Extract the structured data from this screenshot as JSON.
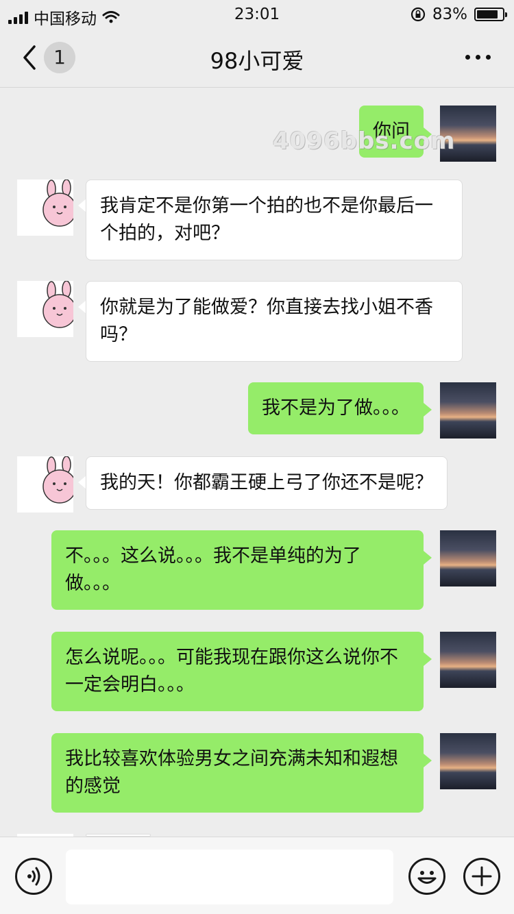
{
  "status_bar": {
    "carrier": "中国移动",
    "time": "23:01",
    "battery_percent": "83%",
    "battery_level": 0.83
  },
  "nav": {
    "unread_count": "1",
    "title": "98小可爱"
  },
  "watermark": "4096bbs.com",
  "messages": [
    {
      "sender": "me",
      "text": "你问"
    },
    {
      "sender": "her",
      "text": "我肯定不是你第一个拍的也不是你最后一个拍的，对吧？"
    },
    {
      "sender": "her",
      "text": "你就是为了能做爱？你直接去找小姐不香吗？"
    },
    {
      "sender": "me",
      "text": "我不是为了做。。。"
    },
    {
      "sender": "her",
      "text": "我的天！你都霸王硬上弓了你还不是呢？"
    },
    {
      "sender": "me",
      "text": "不。。。这么说。。。我不是单纯的为了做。。。"
    },
    {
      "sender": "me",
      "text": "怎么说呢。。。可能我现在跟你这么说你不一定会明白。。。"
    },
    {
      "sender": "me",
      "text": "我比较喜欢体验男女之间充满未知和遐想的感觉"
    }
  ],
  "icons": {
    "back": "chevron-left-icon",
    "more": "more-dots-icon",
    "voice": "voice-icon",
    "emoji": "emoji-icon",
    "plus": "plus-icon"
  },
  "colors": {
    "background": "#ededed",
    "my_bubble": "#95ec69",
    "her_bubble": "#ffffff",
    "avatar_pink": "#f7c6d6"
  }
}
